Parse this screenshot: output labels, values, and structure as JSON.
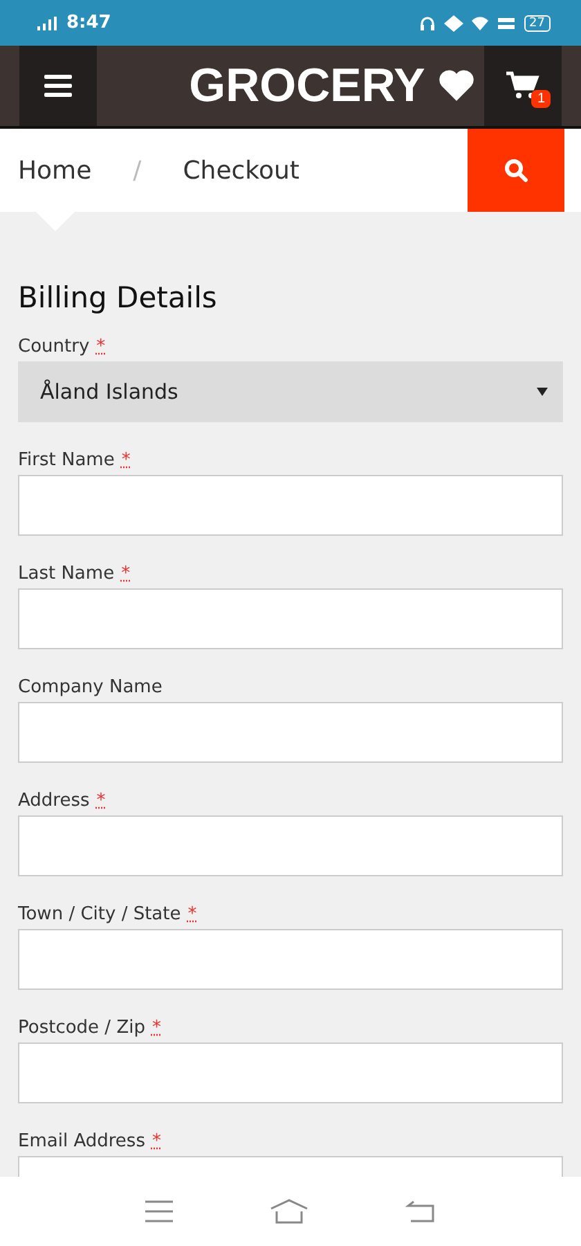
{
  "status_bar": {
    "time": "8:47",
    "battery": "27"
  },
  "header": {
    "logo": "GROCERY",
    "cart_count": "1"
  },
  "breadcrumb": {
    "items": [
      "Home",
      "Checkout"
    ],
    "separator": "/"
  },
  "form": {
    "title": "Billing Details",
    "fields": [
      {
        "kind": "select",
        "label": "Country",
        "required_mark": "*",
        "value": "Åland Islands"
      },
      {
        "kind": "text",
        "label": "First Name",
        "required_mark": "*"
      },
      {
        "kind": "text",
        "label": "Last Name",
        "required_mark": "*"
      },
      {
        "kind": "text",
        "label": "Company Name"
      },
      {
        "kind": "text",
        "label": "Address",
        "required_mark": "*"
      },
      {
        "kind": "text",
        "label": "Town / City / State",
        "required_mark": "*"
      },
      {
        "kind": "text",
        "label": "Postcode / Zip",
        "required_mark": "*"
      },
      {
        "kind": "text",
        "label": "Email Address",
        "required_mark": "*"
      }
    ]
  }
}
